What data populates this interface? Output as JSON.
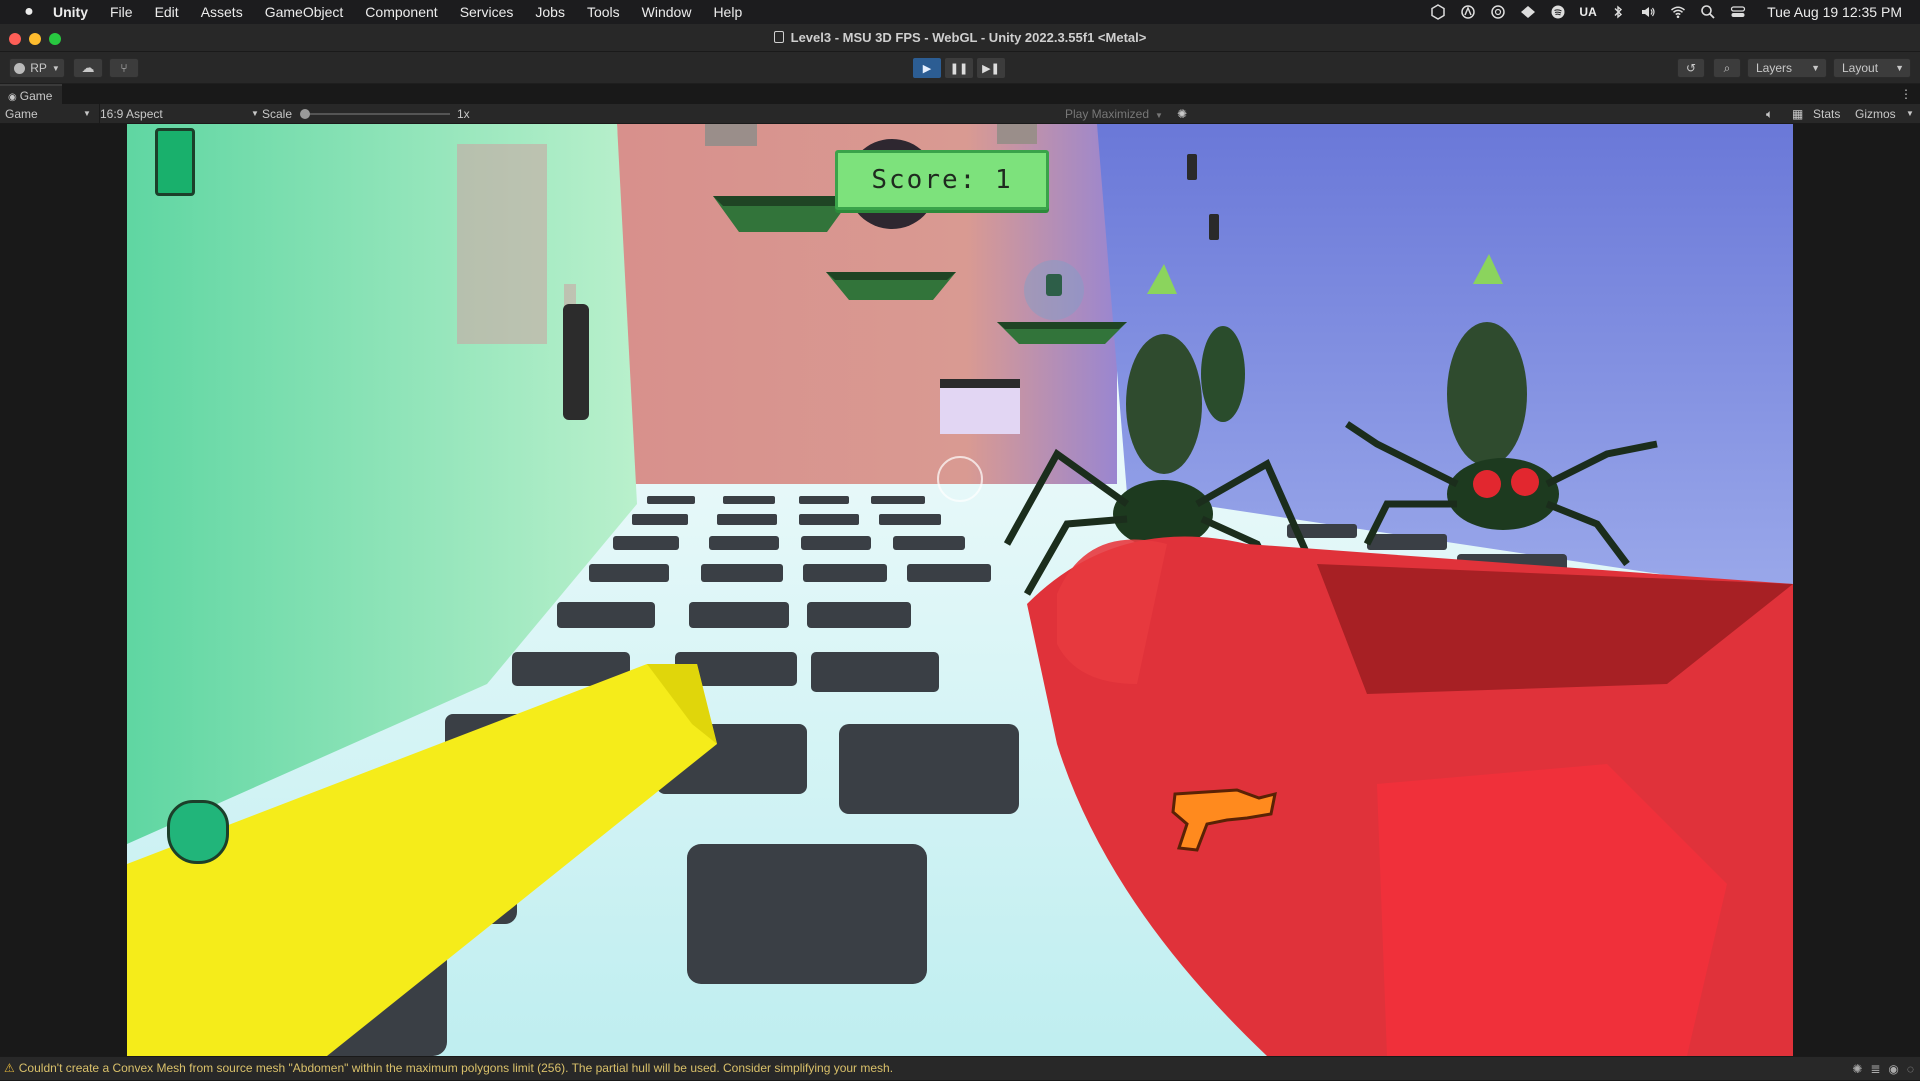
{
  "menubar": {
    "apple": "",
    "items": [
      "Unity",
      "File",
      "Edit",
      "Assets",
      "GameObject",
      "Component",
      "Services",
      "Jobs",
      "Tools",
      "Window",
      "Help"
    ],
    "input_source": "UA",
    "clock": "Tue Aug 19  12:35 PM"
  },
  "window": {
    "title": "Level3 - MSU 3D FPS - WebGL - Unity 2022.3.55f1 <Metal>",
    "traffic_colors": [
      "#fe5f57",
      "#febc2e",
      "#28c840"
    ]
  },
  "toolbar": {
    "account_label": "RP",
    "layers_label": "Layers",
    "layout_label": "Layout",
    "play_active_color": "#2c5d93"
  },
  "game_view": {
    "tab_label": "Game",
    "display_label": "Game",
    "aspect_label": "16:9 Aspect",
    "scale_label": "Scale",
    "scale_value": "1x",
    "play_mode_label": "Play Maximized",
    "stats_label": "Stats",
    "gizmos_label": "Gizmos"
  },
  "hud": {
    "score_text": "Score: 1"
  },
  "console": {
    "message": "Couldn't create a Convex Mesh from source mesh \"Abdomen\" within the maximum polygons limit (256). The partial hull will be used. Consider simplifying your mesh."
  }
}
